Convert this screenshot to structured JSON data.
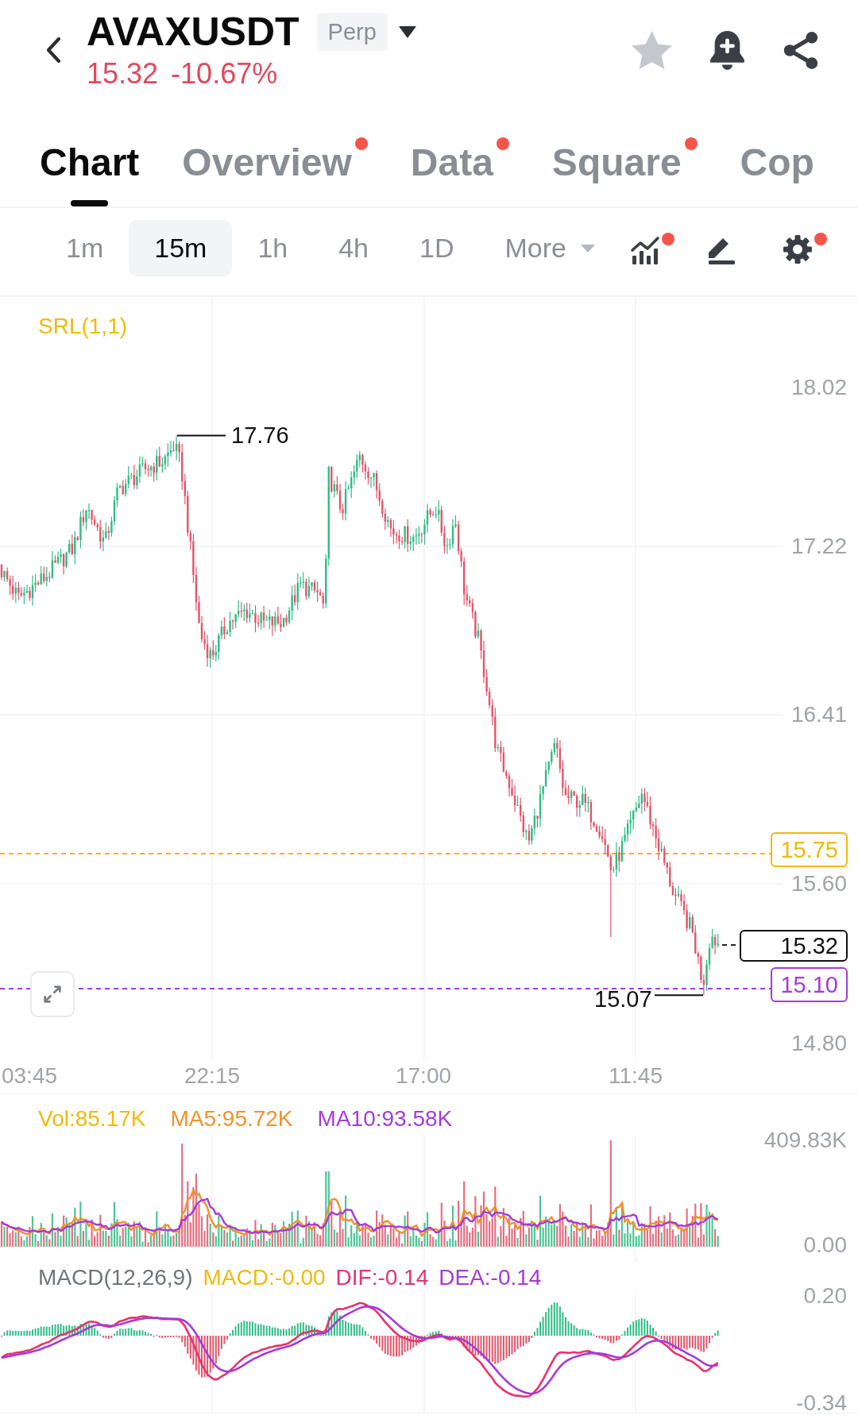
{
  "header": {
    "symbol": "AVAXUSDT",
    "contract_type": "Perp",
    "last_price": "15.32",
    "change": "-10.67%",
    "favorite": false
  },
  "tabs": [
    {
      "label": "Chart",
      "selected": true,
      "dot": false
    },
    {
      "label": "Overview",
      "selected": false,
      "dot": true
    },
    {
      "label": "Data",
      "selected": false,
      "dot": true
    },
    {
      "label": "Square",
      "selected": false,
      "dot": true
    },
    {
      "label": "Cop",
      "selected": false,
      "dot": false
    }
  ],
  "intervals": [
    {
      "label": "1m",
      "selected": false
    },
    {
      "label": "15m",
      "selected": true
    },
    {
      "label": "1h",
      "selected": false
    },
    {
      "label": "4h",
      "selected": false
    },
    {
      "label": "1D",
      "selected": false
    }
  ],
  "more": {
    "label": "More"
  },
  "tools": [
    {
      "kind": "indicators",
      "dot": true
    },
    {
      "kind": "drawing",
      "dot": false
    },
    {
      "kind": "settings",
      "dot": true
    }
  ],
  "price_chart": {
    "indicator": "SRL(1,1)",
    "price_axis": [
      "18.02",
      "17.22",
      "16.41",
      "15.60",
      "14.80"
    ],
    "high_marker": "17.76",
    "low_marker": "15.07",
    "price_tags": [
      {
        "kind": "level",
        "label": "15.75",
        "color": "#f0b90b"
      },
      {
        "kind": "last",
        "label": "15.32"
      },
      {
        "kind": "level",
        "label": "15.10",
        "color": "#a43bd8"
      }
    ],
    "time_axis": [
      "03:45",
      "22:15",
      "17:00",
      "11:45"
    ]
  },
  "volume_panel": {
    "legend": [
      {
        "text": "Vol:85.17K",
        "color": "#f0b90b"
      },
      {
        "text": "MA5:95.72K",
        "color": "#f0922b"
      },
      {
        "text": "MA10:93.58K",
        "color": "#a43bd8"
      }
    ],
    "axis": [
      "409.83K",
      "0.00"
    ]
  },
  "macd_panel": {
    "legend": [
      {
        "text": "MACD(12,26,9)",
        "color": "#6f737a"
      },
      {
        "text": "MACD:-0.00",
        "color": "#f0b90b"
      },
      {
        "text": "DIF:-0.14",
        "color": "#e8336f"
      },
      {
        "text": "DEA:-0.14",
        "color": "#a43bd8"
      }
    ],
    "axis": [
      "0.20",
      "-0.34"
    ]
  }
}
